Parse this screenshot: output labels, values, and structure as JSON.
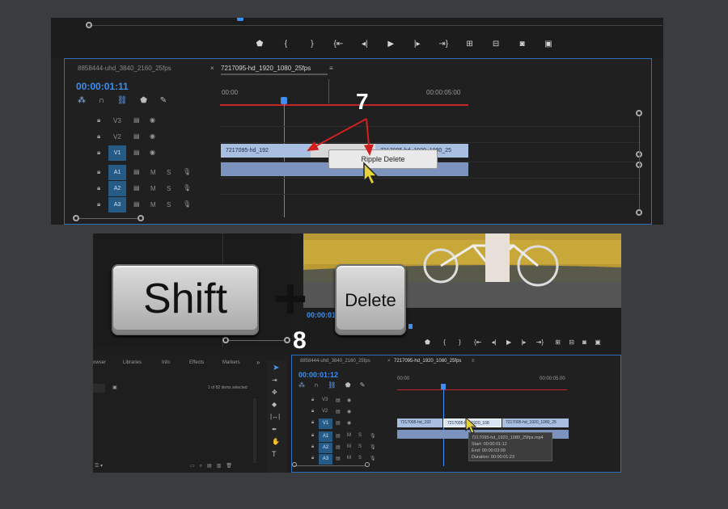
{
  "top": {
    "tabs": [
      "8858444-uhd_3840_2160_25fps",
      "7217095-hd_1920_1080_25fps"
    ],
    "tab_close": "×",
    "tab_menu": "≡",
    "timecode": "00:00:01:11",
    "ruler": [
      "00:00",
      "00:00:05:00"
    ],
    "tracks": [
      {
        "name": "V3",
        "type": "video"
      },
      {
        "name": "V2",
        "type": "video"
      },
      {
        "name": "V1",
        "type": "video",
        "active": true
      },
      {
        "name": "A1",
        "type": "audio",
        "active": true
      },
      {
        "name": "A2",
        "type": "audio",
        "active": true
      },
      {
        "name": "A3",
        "type": "audio",
        "active": true
      }
    ],
    "audio_m": "M",
    "audio_s": "S",
    "clips": [
      "7217095-hd_192",
      "7217095-hd_1920_1080_25"
    ],
    "context_menu_item": "Ripple Delete",
    "step_label": "7"
  },
  "keys": {
    "shift": "Shift",
    "plus": "+",
    "delete": "Delete"
  },
  "bottom": {
    "step_label": "8",
    "preview_timecode": "00:00:01:",
    "panel_tabs": [
      "owser",
      "Libraries",
      "Info",
      "Effects",
      "Markers"
    ],
    "panel_more": "»",
    "items_count": "1 of 82 items selected",
    "tabs": [
      "8858444-uhd_3840_2160_25fps",
      "7217095-hd_1920_1080_25fps"
    ],
    "tab_close": "×",
    "tab_menu": "≡",
    "timecode": "00:00:01:12",
    "ruler": [
      "00:00",
      "00:00:05:00"
    ],
    "tracks": [
      {
        "name": "V3"
      },
      {
        "name": "V2"
      },
      {
        "name": "V1"
      },
      {
        "name": "A1"
      },
      {
        "name": "A2"
      },
      {
        "name": "A3"
      }
    ],
    "audio_m": "M",
    "audio_s": "S",
    "clips": [
      "7217095-hd_192",
      "7217095-hd_1920_108",
      "7217095-hd_1920_1080_25"
    ],
    "tooltip": {
      "file": "7217095-hd_1920_1080_25fps.mp4",
      "start": "Start: 00:00:01:12",
      "end": "End: 00:00:03:09",
      "duration": "Duration: 00:00:01:23"
    }
  },
  "colors": {
    "accent": "#3d8ef0",
    "arrow": "#d21f1f",
    "clip": "#a9bfe1"
  }
}
